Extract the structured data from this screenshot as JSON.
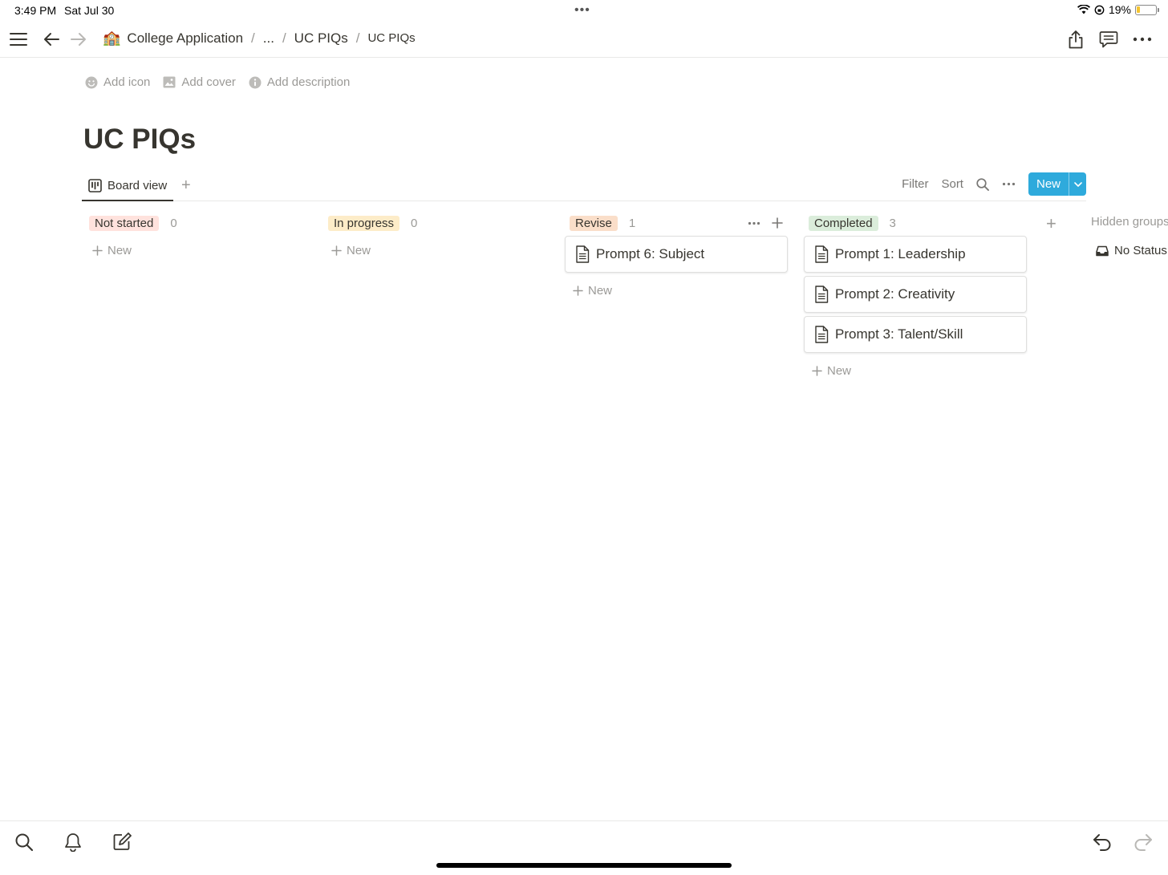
{
  "status_bar": {
    "time": "3:49 PM",
    "date": "Sat Jul 30",
    "battery": "19%",
    "battery_level": 0.19
  },
  "breadcrumb": {
    "emoji": "🏫",
    "root": "College Application",
    "ellipsis": "...",
    "parent": "UC PIQs",
    "current": "UC PIQs"
  },
  "page_actions": {
    "add_icon": "Add icon",
    "add_cover": "Add cover",
    "add_description": "Add description"
  },
  "page": {
    "title": "UC PIQs"
  },
  "view": {
    "tab_label": "Board view",
    "filter": "Filter",
    "sort": "Sort",
    "new_button": "New"
  },
  "columns": [
    {
      "label": "Not started",
      "count": "0",
      "color": "#ffe2dd",
      "new_label": "New",
      "cards": []
    },
    {
      "label": "In progress",
      "count": "0",
      "color": "#fdecc8",
      "new_label": "New",
      "cards": []
    },
    {
      "label": "Revise",
      "count": "1",
      "color": "#fadec9",
      "new_label": "New",
      "cards": [
        "Prompt 6: Subject"
      ]
    },
    {
      "label": "Completed",
      "count": "3",
      "color": "#dbeddb",
      "new_label": "New",
      "cards": [
        "Prompt 1: Leadership",
        "Prompt 2: Creativity",
        "Prompt 3: Talent/Skill"
      ]
    }
  ],
  "hidden_groups": {
    "label": "Hidden groups",
    "no_status": "No Status"
  },
  "icons": {
    "menu": "hamburger-icon",
    "back": "arrow-left-icon",
    "forward": "arrow-right-icon",
    "share": "share-icon",
    "comments": "comment-icon",
    "more": "more-icon",
    "search": "search-icon",
    "bell": "bell-icon",
    "compose": "compose-icon",
    "undo": "undo-icon",
    "redo": "redo-icon"
  }
}
